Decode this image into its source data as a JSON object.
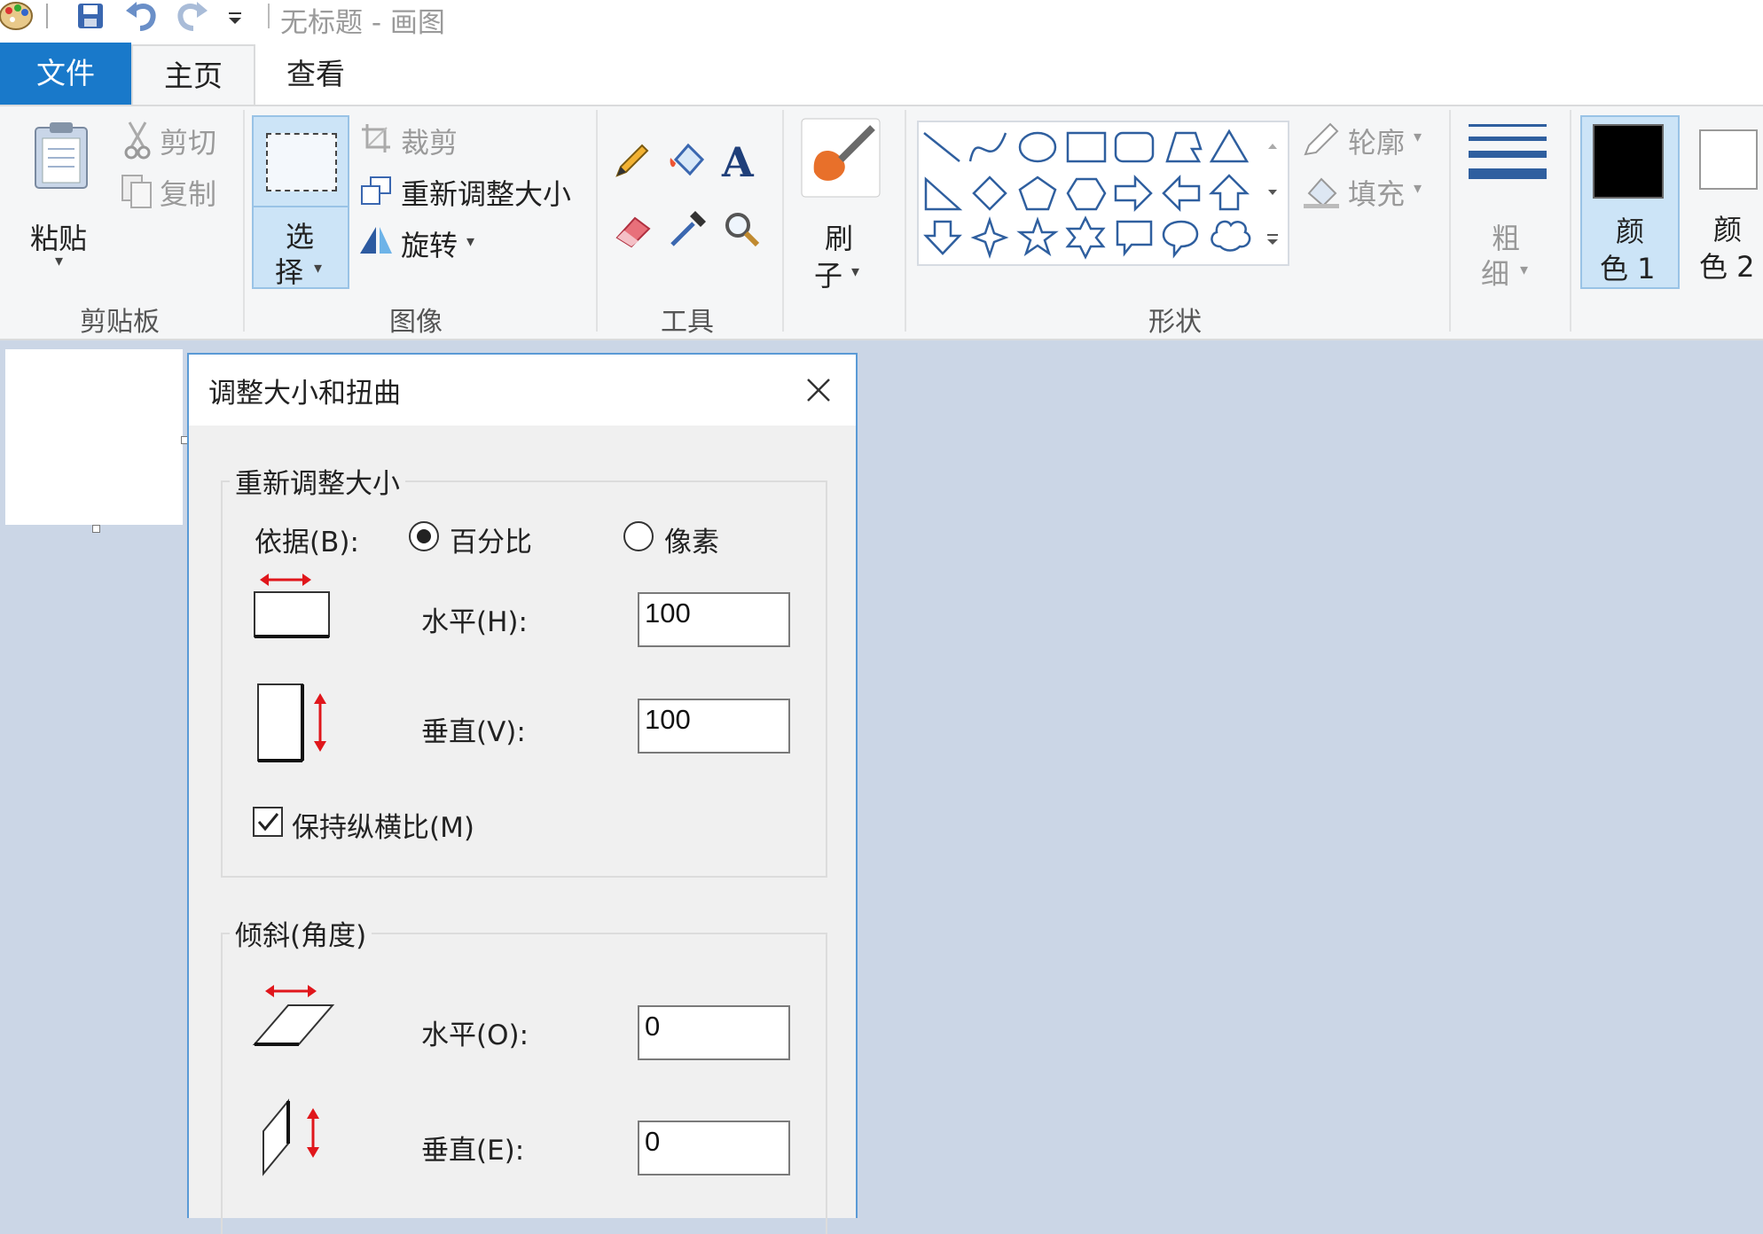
{
  "window": {
    "title": "无标题 - 画图"
  },
  "quick_access": {
    "icons": [
      "paint-app-icon",
      "save-icon",
      "undo-icon",
      "redo-icon",
      "customize-toolbar-icon"
    ]
  },
  "tabs": {
    "file": "文件",
    "home": "主页",
    "view": "查看"
  },
  "ribbon": {
    "clipboard": {
      "paste": "粘贴",
      "cut": "剪切",
      "copy": "复制",
      "group": "剪贴板"
    },
    "image": {
      "select_1": "选",
      "select_2": "择",
      "crop": "裁剪",
      "resize": "重新调整大小",
      "rotate": "旋转",
      "group": "图像"
    },
    "tools": {
      "group": "工具",
      "text_icon_glyph": "A"
    },
    "brushes": {
      "label_1": "刷",
      "label_2": "子"
    },
    "shapes": {
      "outline": "轮廓",
      "fill": "填充",
      "group": "形状"
    },
    "size": {
      "label_1": "粗",
      "label_2": "细"
    },
    "color1": {
      "label_1": "颜",
      "label_2": "色 1",
      "value": "#000000"
    },
    "color2": {
      "label_1": "颜",
      "label_2": "色 2",
      "value": "#ffffff"
    }
  },
  "dialog": {
    "title": "调整大小和扭曲",
    "resize": {
      "legend": "重新调整大小",
      "by_label": "依据(B):",
      "percent_label": "百分比",
      "pixels_label": "像素",
      "selected": "百分比",
      "horizontal_label": "水平(H):",
      "horizontal_value": "100",
      "vertical_label": "垂直(V):",
      "vertical_value": "100",
      "keep_ratio_label": "保持纵横比(M)",
      "keep_ratio_checked": true
    },
    "skew": {
      "legend": "倾斜(角度)",
      "horizontal_label": "水平(O):",
      "horizontal_value": "0",
      "vertical_label": "垂直(E):",
      "vertical_value": "0"
    }
  },
  "colors": {
    "accent": "#1979ca",
    "workspace": "#cbd6e6",
    "arrow_red": "#e0161b",
    "dialog_border": "#5a9ad6"
  }
}
